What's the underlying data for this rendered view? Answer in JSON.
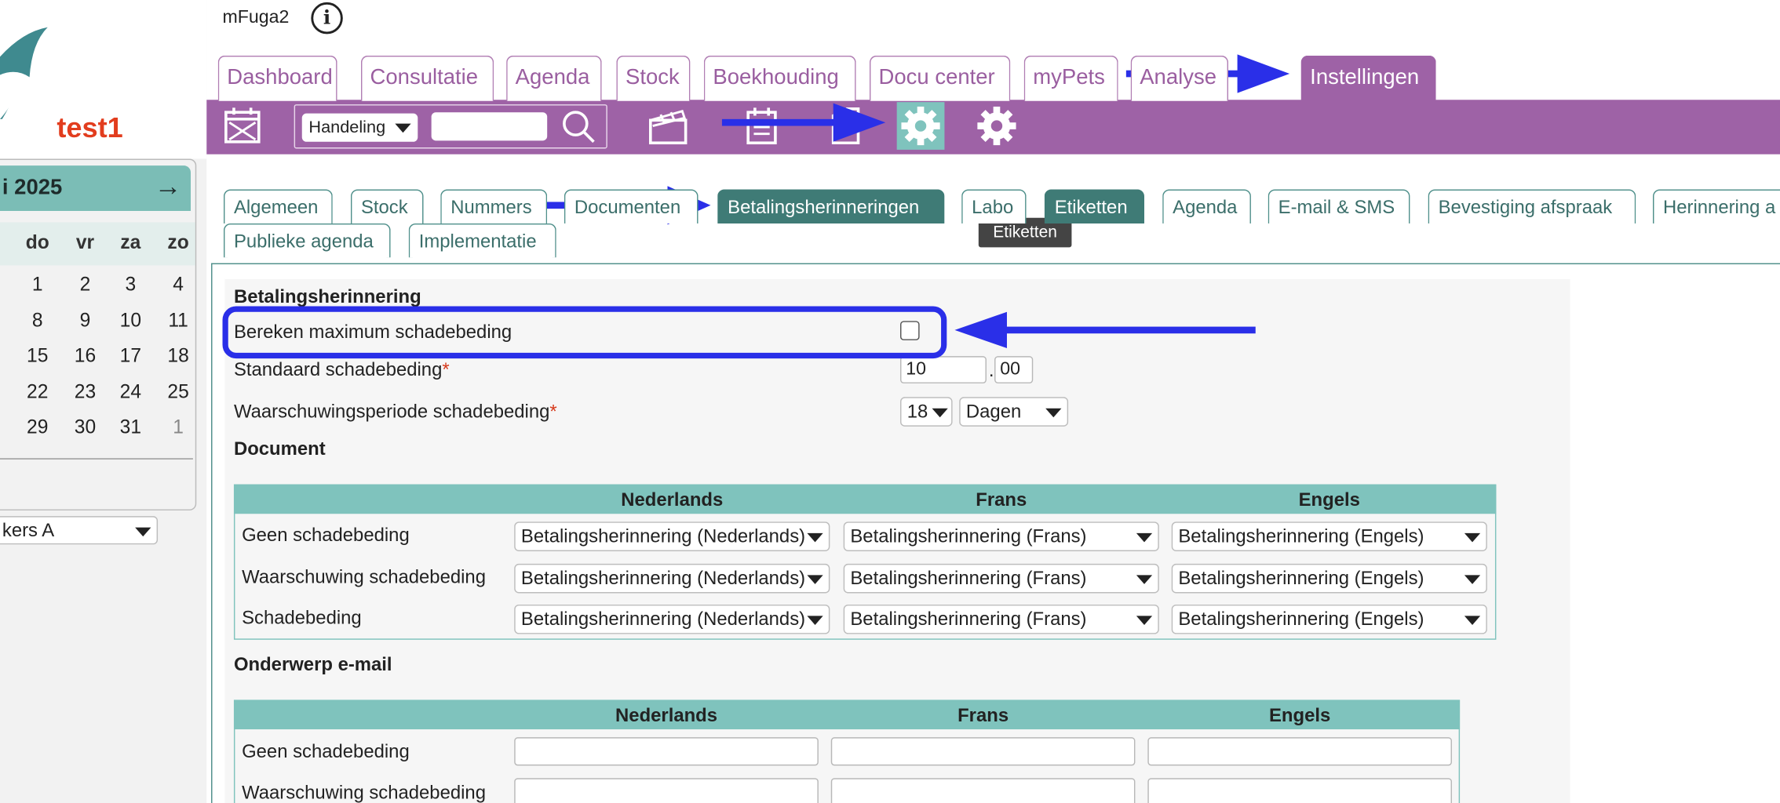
{
  "app": {
    "title": "mFuga2",
    "info_symbol": "i"
  },
  "sidebar": {
    "practice_name": "test1",
    "calendar": {
      "month_label": "i 2025",
      "next_symbol": "→",
      "day_names": [
        "do",
        "vr",
        "za",
        "zo"
      ],
      "weeks": [
        [
          "1",
          "2",
          "3",
          "4"
        ],
        [
          "8",
          "9",
          "10",
          "11"
        ],
        [
          "15",
          "16",
          "17",
          "18"
        ],
        [
          "22",
          "23",
          "24",
          "25"
        ],
        [
          "29",
          "30",
          "31",
          "1"
        ]
      ]
    },
    "user_select": "kers A"
  },
  "main_tabs": [
    "Dashboard",
    "Consultatie",
    "Agenda",
    "Stock",
    "Boekhouding",
    "Docu center",
    "myPets",
    "Analyse",
    "Instellingen"
  ],
  "main_tab_active": "Instellingen",
  "toolbar": {
    "search_type": "Handeling",
    "search_value": ""
  },
  "sub_tabs_row1": [
    "Algemeen",
    "Stock",
    "Nummers",
    "Documenten",
    "Betalingsherinneringen",
    "Labo",
    "Etiketten",
    "Agenda",
    "E-mail & SMS",
    "Bevestiging afspraak",
    "Herinnering a"
  ],
  "sub_tabs_row2": [
    "Publieke agenda",
    "Implementatie"
  ],
  "sub_tab_active": "Betalingsherinneringen",
  "tooltip": "Etiketten",
  "form": {
    "section_title": "Betalingsherinnering",
    "bereken_label": "Bereken maximum schadebeding",
    "standaard_label": "Standaard schadebeding",
    "standaard_whole": "10",
    "standaard_decimal": "00",
    "decimal_sep": ".",
    "waarschuwing_label": "Waarschuwingsperiode schadebeding",
    "waarschuwing_value": "18",
    "waarschuwing_unit": "Dagen",
    "required_mark": "*",
    "document_title": "Document",
    "doc_headers": [
      "Nederlands",
      "Frans",
      "Engels"
    ],
    "doc_rows": [
      {
        "label": "Geen schadebeding",
        "values": [
          "Betalingsherinnering (Nederlands)",
          "Betalingsherinnering (Frans)",
          "Betalingsherinnering (Engels)"
        ]
      },
      {
        "label": "Waarschuwing schadebeding",
        "values": [
          "Betalingsherinnering (Nederlands)",
          "Betalingsherinnering (Frans)",
          "Betalingsherinnering (Engels)"
        ]
      },
      {
        "label": "Schadebeding",
        "values": [
          "Betalingsherinnering (Nederlands)",
          "Betalingsherinnering (Frans)",
          "Betalingsherinnering (Engels)"
        ]
      }
    ],
    "email_title": "Onderwerp e-mail",
    "email_headers": [
      "Nederlands",
      "Frans",
      "Engels"
    ],
    "email_rows": [
      "Geen schadebeding",
      "Waarschuwing schadebeding"
    ]
  },
  "colors": {
    "brand_purple": "#9e62a6",
    "teal": "#3f7b76",
    "teal_light": "#7fc3bd",
    "annotation_blue": "#2a2fe8",
    "logo_red": "#e23d1e"
  }
}
